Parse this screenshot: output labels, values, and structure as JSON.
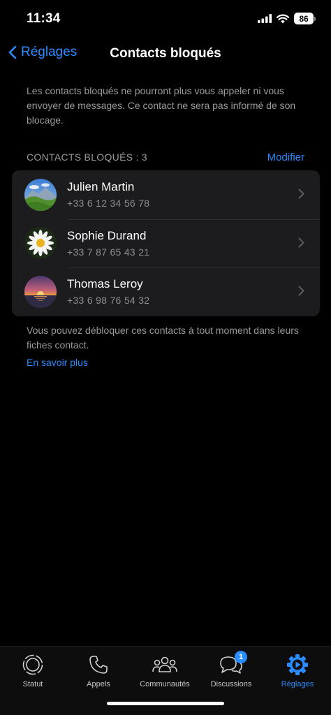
{
  "status_bar": {
    "time": "11:34",
    "battery": "86"
  },
  "nav": {
    "back_label": "Réglages",
    "title": "Contacts bloqués"
  },
  "info_text": "Les contacts bloqués ne pourront plus vous appeler ni vous envoyer de messages. Ce contact ne sera pas informé de son blocage.",
  "section": {
    "title": "CONTACTS BLOQUÉS : 3",
    "edit_label": "Modifier"
  },
  "contacts": [
    {
      "name": "Julien Martin",
      "phone": "+33 6 12 34 56 78",
      "avatar": "mountain-landscape"
    },
    {
      "name": "Sophie Durand",
      "phone": "+33 7 87 65 43 21",
      "avatar": "daisy-flower"
    },
    {
      "name": "Thomas Leroy",
      "phone": "+33 6 98 76 54 32",
      "avatar": "sunset-sea"
    }
  ],
  "footer": {
    "text": "Vous pouvez débloquer ces contacts à tout moment dans leurs fiches contact.",
    "learn_more": "En savoir plus"
  },
  "tabs": [
    {
      "label": "Statut",
      "icon": "status-icon",
      "active": false
    },
    {
      "label": "Appels",
      "icon": "phone-icon",
      "active": false
    },
    {
      "label": "Communautés",
      "icon": "communities-icon",
      "active": false
    },
    {
      "label": "Discussions",
      "icon": "chat-icon",
      "active": false,
      "badge": "1"
    },
    {
      "label": "Réglages",
      "icon": "settings-icon",
      "active": true
    }
  ],
  "colors": {
    "accent": "#2b8cff",
    "background": "#000000",
    "cell": "#1c1c1e",
    "secondary_text": "#9a9aa0"
  }
}
